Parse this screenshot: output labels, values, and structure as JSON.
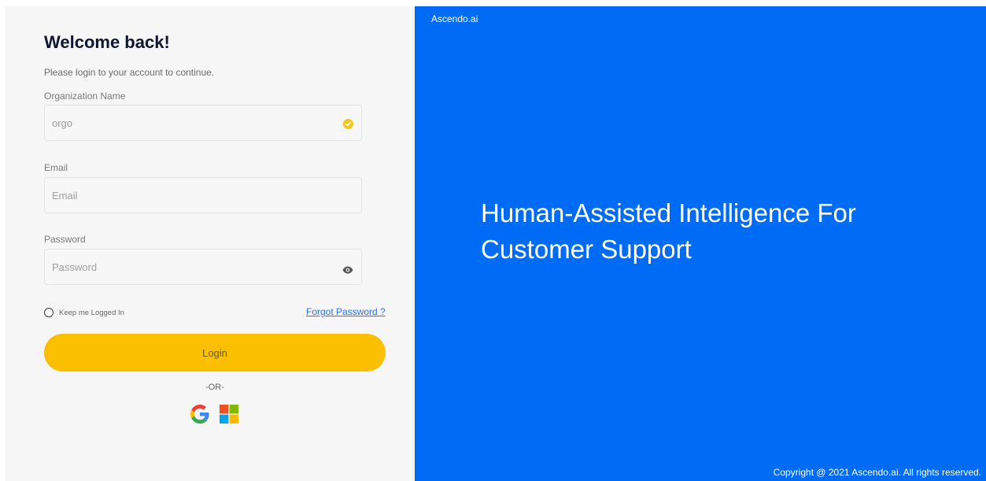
{
  "login": {
    "title": "Welcome back!",
    "subtitle": "Please login to your account to continue.",
    "org": {
      "label": "Organization Name",
      "value": "orgo",
      "status_icon": "check-circle-icon"
    },
    "email": {
      "label": "Email",
      "placeholder": "Email",
      "value": ""
    },
    "password": {
      "label": "Password",
      "placeholder": "Password",
      "value": "",
      "toggle_icon": "eye-icon"
    },
    "remember_label": "Keep me Logged In",
    "remember_checked": false,
    "forgot_label": "Forgot Password ?",
    "login_label": "Login",
    "or_label": "-OR-",
    "social": [
      "google-icon",
      "microsoft-icon"
    ]
  },
  "hero": {
    "brand": "Ascendo.ai",
    "headline": "Human-Assisted Intelligence For Customer Support",
    "copyright": "Copyright @ 2021 Ascendo.ai. All rights reserved."
  },
  "colors": {
    "accent_blue": "#006cf5",
    "login_yellow": "#fabf00",
    "title_dark": "#0f1730",
    "link_blue": "#2f72e6",
    "panel_bg": "#f6f6f6"
  }
}
